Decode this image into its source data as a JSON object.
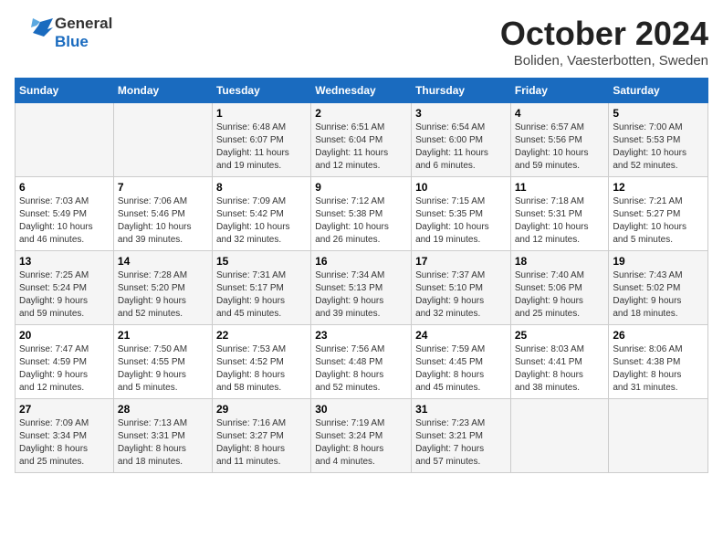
{
  "header": {
    "logo_general": "General",
    "logo_blue": "Blue",
    "month": "October 2024",
    "location": "Boliden, Vaesterbotten, Sweden"
  },
  "days_of_week": [
    "Sunday",
    "Monday",
    "Tuesday",
    "Wednesday",
    "Thursday",
    "Friday",
    "Saturday"
  ],
  "weeks": [
    [
      {
        "day": "",
        "info": ""
      },
      {
        "day": "",
        "info": ""
      },
      {
        "day": "1",
        "info": "Sunrise: 6:48 AM\nSunset: 6:07 PM\nDaylight: 11 hours\nand 19 minutes."
      },
      {
        "day": "2",
        "info": "Sunrise: 6:51 AM\nSunset: 6:04 PM\nDaylight: 11 hours\nand 12 minutes."
      },
      {
        "day": "3",
        "info": "Sunrise: 6:54 AM\nSunset: 6:00 PM\nDaylight: 11 hours\nand 6 minutes."
      },
      {
        "day": "4",
        "info": "Sunrise: 6:57 AM\nSunset: 5:56 PM\nDaylight: 10 hours\nand 59 minutes."
      },
      {
        "day": "5",
        "info": "Sunrise: 7:00 AM\nSunset: 5:53 PM\nDaylight: 10 hours\nand 52 minutes."
      }
    ],
    [
      {
        "day": "6",
        "info": "Sunrise: 7:03 AM\nSunset: 5:49 PM\nDaylight: 10 hours\nand 46 minutes."
      },
      {
        "day": "7",
        "info": "Sunrise: 7:06 AM\nSunset: 5:46 PM\nDaylight: 10 hours\nand 39 minutes."
      },
      {
        "day": "8",
        "info": "Sunrise: 7:09 AM\nSunset: 5:42 PM\nDaylight: 10 hours\nand 32 minutes."
      },
      {
        "day": "9",
        "info": "Sunrise: 7:12 AM\nSunset: 5:38 PM\nDaylight: 10 hours\nand 26 minutes."
      },
      {
        "day": "10",
        "info": "Sunrise: 7:15 AM\nSunset: 5:35 PM\nDaylight: 10 hours\nand 19 minutes."
      },
      {
        "day": "11",
        "info": "Sunrise: 7:18 AM\nSunset: 5:31 PM\nDaylight: 10 hours\nand 12 minutes."
      },
      {
        "day": "12",
        "info": "Sunrise: 7:21 AM\nSunset: 5:27 PM\nDaylight: 10 hours\nand 5 minutes."
      }
    ],
    [
      {
        "day": "13",
        "info": "Sunrise: 7:25 AM\nSunset: 5:24 PM\nDaylight: 9 hours\nand 59 minutes."
      },
      {
        "day": "14",
        "info": "Sunrise: 7:28 AM\nSunset: 5:20 PM\nDaylight: 9 hours\nand 52 minutes."
      },
      {
        "day": "15",
        "info": "Sunrise: 7:31 AM\nSunset: 5:17 PM\nDaylight: 9 hours\nand 45 minutes."
      },
      {
        "day": "16",
        "info": "Sunrise: 7:34 AM\nSunset: 5:13 PM\nDaylight: 9 hours\nand 39 minutes."
      },
      {
        "day": "17",
        "info": "Sunrise: 7:37 AM\nSunset: 5:10 PM\nDaylight: 9 hours\nand 32 minutes."
      },
      {
        "day": "18",
        "info": "Sunrise: 7:40 AM\nSunset: 5:06 PM\nDaylight: 9 hours\nand 25 minutes."
      },
      {
        "day": "19",
        "info": "Sunrise: 7:43 AM\nSunset: 5:02 PM\nDaylight: 9 hours\nand 18 minutes."
      }
    ],
    [
      {
        "day": "20",
        "info": "Sunrise: 7:47 AM\nSunset: 4:59 PM\nDaylight: 9 hours\nand 12 minutes."
      },
      {
        "day": "21",
        "info": "Sunrise: 7:50 AM\nSunset: 4:55 PM\nDaylight: 9 hours\nand 5 minutes."
      },
      {
        "day": "22",
        "info": "Sunrise: 7:53 AM\nSunset: 4:52 PM\nDaylight: 8 hours\nand 58 minutes."
      },
      {
        "day": "23",
        "info": "Sunrise: 7:56 AM\nSunset: 4:48 PM\nDaylight: 8 hours\nand 52 minutes."
      },
      {
        "day": "24",
        "info": "Sunrise: 7:59 AM\nSunset: 4:45 PM\nDaylight: 8 hours\nand 45 minutes."
      },
      {
        "day": "25",
        "info": "Sunrise: 8:03 AM\nSunset: 4:41 PM\nDaylight: 8 hours\nand 38 minutes."
      },
      {
        "day": "26",
        "info": "Sunrise: 8:06 AM\nSunset: 4:38 PM\nDaylight: 8 hours\nand 31 minutes."
      }
    ],
    [
      {
        "day": "27",
        "info": "Sunrise: 7:09 AM\nSunset: 3:34 PM\nDaylight: 8 hours\nand 25 minutes."
      },
      {
        "day": "28",
        "info": "Sunrise: 7:13 AM\nSunset: 3:31 PM\nDaylight: 8 hours\nand 18 minutes."
      },
      {
        "day": "29",
        "info": "Sunrise: 7:16 AM\nSunset: 3:27 PM\nDaylight: 8 hours\nand 11 minutes."
      },
      {
        "day": "30",
        "info": "Sunrise: 7:19 AM\nSunset: 3:24 PM\nDaylight: 8 hours\nand 4 minutes."
      },
      {
        "day": "31",
        "info": "Sunrise: 7:23 AM\nSunset: 3:21 PM\nDaylight: 7 hours\nand 57 minutes."
      },
      {
        "day": "",
        "info": ""
      },
      {
        "day": "",
        "info": ""
      }
    ]
  ]
}
